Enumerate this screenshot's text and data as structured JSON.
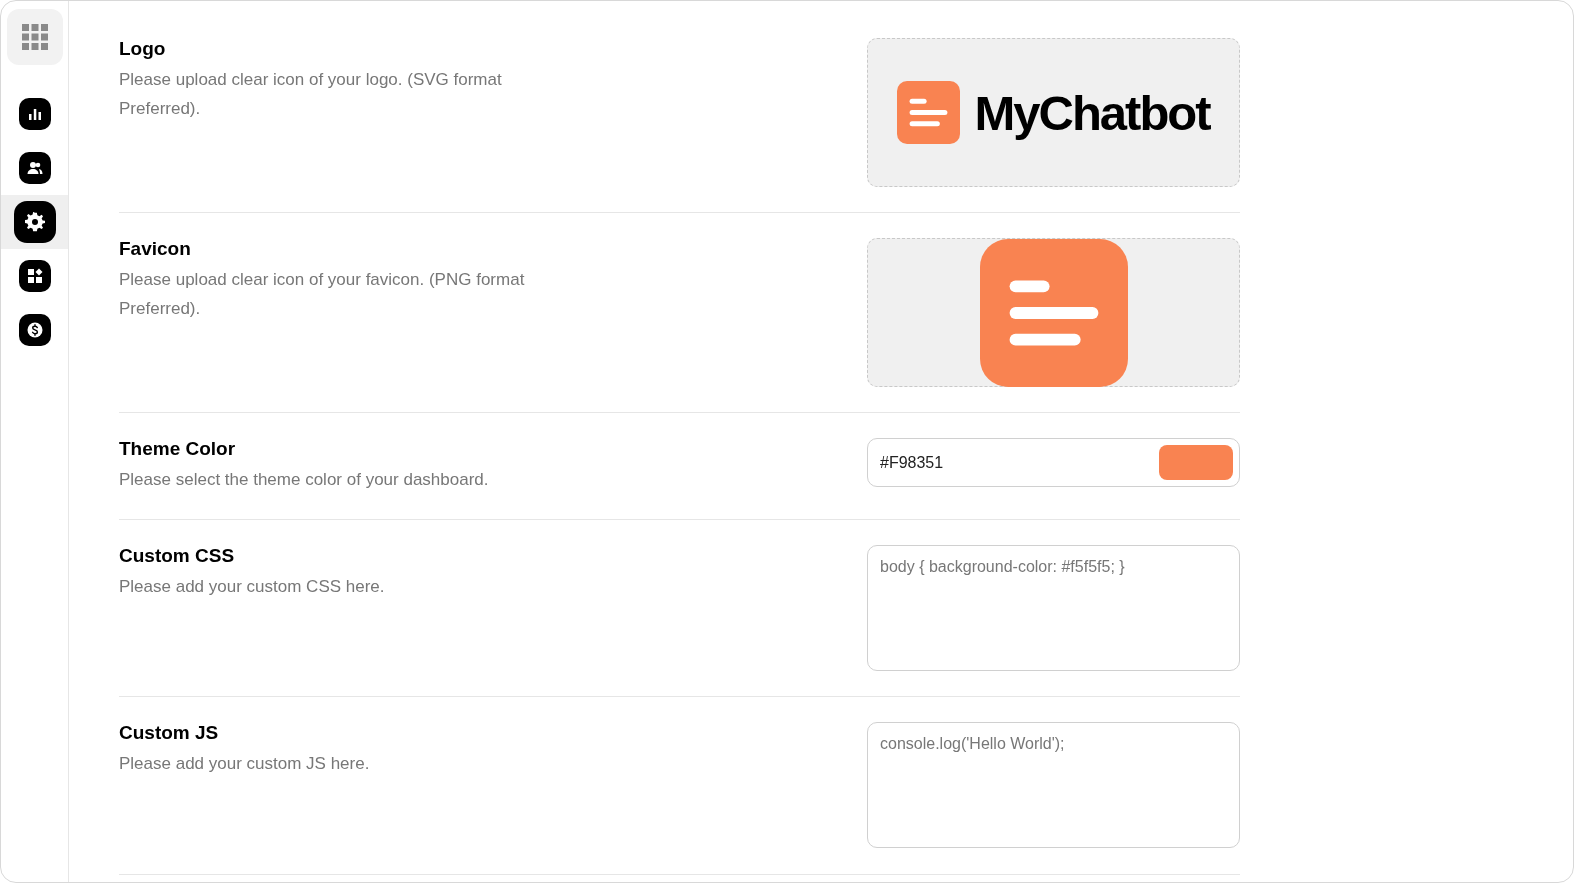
{
  "sidebar": {
    "items": [
      {
        "kind": "chart",
        "selected": false
      },
      {
        "kind": "users",
        "selected": false
      },
      {
        "kind": "settings",
        "selected": true
      },
      {
        "kind": "widgets",
        "selected": false
      },
      {
        "kind": "billing",
        "selected": false
      }
    ]
  },
  "settings": [
    {
      "kind": "logo",
      "title": "Logo",
      "description": "Please upload clear icon of your logo. (SVG format Preferred).",
      "logo_text": "MyChatbot"
    },
    {
      "kind": "favicon",
      "title": "Favicon",
      "description": "Please upload clear icon of your favicon. (PNG format Preferred)."
    },
    {
      "kind": "color",
      "title": "Theme Color",
      "description": "Please select the theme color of your dashboard.",
      "value": "#F98351",
      "color": "#f98351"
    },
    {
      "kind": "code",
      "title": "Custom CSS",
      "description": "Please add your custom CSS here.",
      "placeholder": "body { background-color: #f5f5f5; }"
    },
    {
      "kind": "code",
      "title": "Custom JS",
      "description": "Please add your custom JS here.",
      "placeholder": "console.log('Hello World');"
    }
  ]
}
